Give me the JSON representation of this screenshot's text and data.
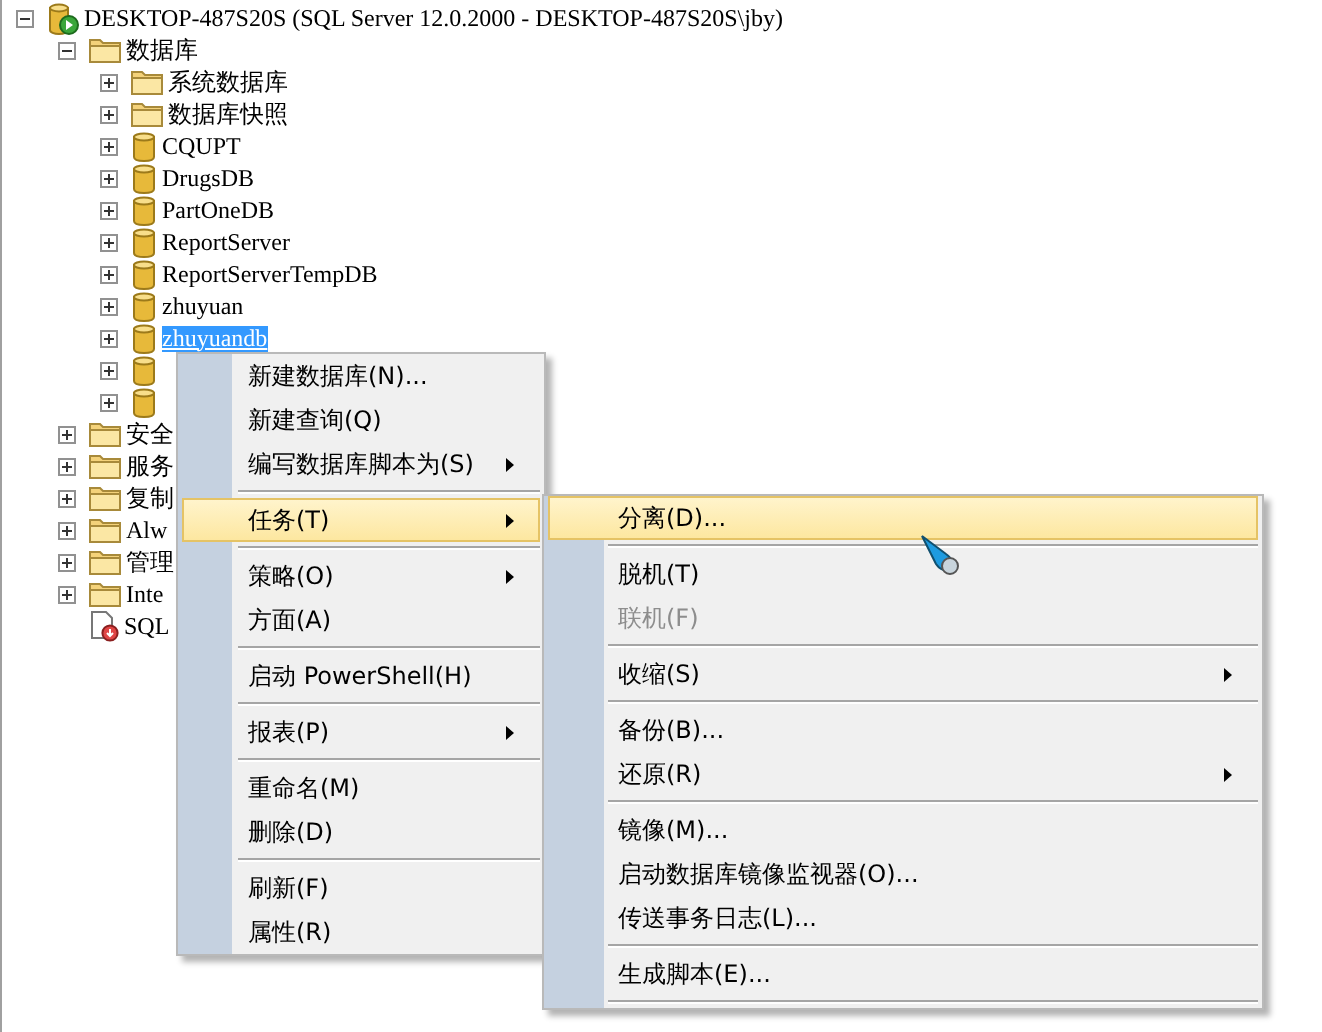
{
  "tree": {
    "kind": "server",
    "label": "DESKTOP-487S20S (SQL Server 12.0.2000 - DESKTOP-487S20S\\jby)",
    "expanded": true,
    "selected": false,
    "children": [
      {
        "kind": "folder",
        "label": "数据库",
        "expanded": true,
        "selected": false,
        "children": [
          {
            "kind": "folder",
            "label": "系统数据库",
            "expanded": false,
            "selected": false
          },
          {
            "kind": "folder",
            "label": "数据库快照",
            "expanded": false,
            "selected": false
          },
          {
            "kind": "database",
            "label": "CQUPT",
            "expanded": false,
            "selected": false
          },
          {
            "kind": "database",
            "label": "DrugsDB",
            "expanded": false,
            "selected": false
          },
          {
            "kind": "database",
            "label": "PartOneDB",
            "expanded": false,
            "selected": false
          },
          {
            "kind": "database",
            "label": "ReportServer",
            "expanded": false,
            "selected": false
          },
          {
            "kind": "database",
            "label": "ReportServerTempDB",
            "expanded": false,
            "selected": false
          },
          {
            "kind": "database",
            "label": "zhuyuan",
            "expanded": false,
            "selected": false
          },
          {
            "kind": "database",
            "label": "zhuyuandb",
            "expanded": false,
            "selected": true
          },
          {
            "kind": "database",
            "expanded": false,
            "selected": false
          },
          {
            "kind": "database",
            "expanded": false,
            "selected": false
          }
        ]
      },
      {
        "kind": "folder",
        "label": "安全",
        "expanded": false,
        "selected": false
      },
      {
        "kind": "folder",
        "label": "服务",
        "expanded": false,
        "selected": false
      },
      {
        "kind": "folder",
        "label": "复制",
        "expanded": false,
        "selected": false
      },
      {
        "kind": "folder",
        "label": "Alw",
        "expanded": false,
        "selected": false
      },
      {
        "kind": "folder",
        "label": "管理",
        "expanded": false,
        "selected": false
      },
      {
        "kind": "folder",
        "label": "Inte",
        "expanded": false,
        "selected": false
      },
      {
        "kind": "agent",
        "label": "SQL",
        "selected": false
      }
    ]
  },
  "context_menu": [
    {
      "kind": "item",
      "label": "新建数据库(N)...",
      "submenu": false,
      "selected": false
    },
    {
      "kind": "item",
      "label": "新建查询(Q)",
      "submenu": false,
      "selected": false
    },
    {
      "kind": "item",
      "label": "编写数据库脚本为(S)",
      "submenu": true,
      "selected": false
    },
    {
      "kind": "separator"
    },
    {
      "kind": "item",
      "label": "任务(T)",
      "submenu": true,
      "selected": true
    },
    {
      "kind": "separator"
    },
    {
      "kind": "item",
      "label": "策略(O)",
      "submenu": true,
      "selected": false
    },
    {
      "kind": "item",
      "label": "方面(A)",
      "submenu": false,
      "selected": false
    },
    {
      "kind": "separator"
    },
    {
      "kind": "item",
      "label": "启动 PowerShell(H)",
      "submenu": false,
      "selected": false
    },
    {
      "kind": "separator"
    },
    {
      "kind": "item",
      "label": "报表(P)",
      "submenu": true,
      "selected": false
    },
    {
      "kind": "separator"
    },
    {
      "kind": "item",
      "label": "重命名(M)",
      "submenu": false,
      "selected": false
    },
    {
      "kind": "item",
      "label": "删除(D)",
      "submenu": false,
      "selected": false
    },
    {
      "kind": "separator"
    },
    {
      "kind": "item",
      "label": "刷新(F)",
      "submenu": false,
      "selected": false
    },
    {
      "kind": "item",
      "label": "属性(R)",
      "submenu": false,
      "selected": false
    }
  ],
  "tasks_submenu": [
    {
      "kind": "item",
      "label": "分离(D)...",
      "submenu": false,
      "selected": true,
      "disabled": false
    },
    {
      "kind": "separator"
    },
    {
      "kind": "item",
      "label": "脱机(T)",
      "submenu": false,
      "selected": false,
      "disabled": false
    },
    {
      "kind": "item",
      "label": "联机(F)",
      "submenu": false,
      "selected": false,
      "disabled": true
    },
    {
      "kind": "separator"
    },
    {
      "kind": "item",
      "label": "收缩(S)",
      "submenu": true,
      "selected": false,
      "disabled": false
    },
    {
      "kind": "separator"
    },
    {
      "kind": "item",
      "label": "备份(B)...",
      "submenu": false,
      "selected": false,
      "disabled": false
    },
    {
      "kind": "item",
      "label": "还原(R)",
      "submenu": true,
      "selected": false,
      "disabled": false
    },
    {
      "kind": "separator"
    },
    {
      "kind": "item",
      "label": "镜像(M)...",
      "submenu": false,
      "selected": false,
      "disabled": false
    },
    {
      "kind": "item",
      "label": "启动数据库镜像监视器(O)...",
      "submenu": false,
      "selected": false,
      "disabled": false
    },
    {
      "kind": "item",
      "label": "传送事务日志(L)...",
      "submenu": false,
      "selected": false,
      "disabled": false
    },
    {
      "kind": "separator"
    },
    {
      "kind": "item",
      "label": "生成脚本(E)...",
      "submenu": false,
      "selected": false,
      "disabled": false
    },
    {
      "kind": "separator"
    }
  ]
}
